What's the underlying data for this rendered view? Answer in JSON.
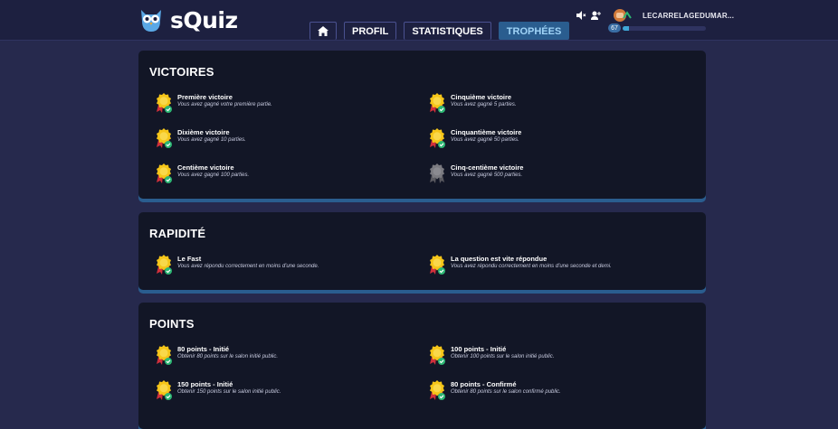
{
  "brand": {
    "name": "sQuiz"
  },
  "nav": {
    "home_icon": "home-icon",
    "tabs": [
      {
        "label": "PROFIL",
        "active": false
      },
      {
        "label": "STATISTIQUES",
        "active": false
      },
      {
        "label": "TROPHÉES",
        "active": true
      }
    ]
  },
  "user": {
    "name": "LECARRELAGEDUMAR...",
    "level": "67",
    "xp_progress_percent": 8
  },
  "colors": {
    "background": "#26294d",
    "panel": "#121626",
    "accent": "#2a5d8f",
    "gold": "#f5c518",
    "check": "#2bb673",
    "locked": "#7a7a80"
  },
  "sections": [
    {
      "title": "VICTOIRES",
      "trophies": [
        {
          "title": "Première victoire",
          "desc": "Vous avez gagné votre première partie.",
          "unlocked": true
        },
        {
          "title": "Cinquième victoire",
          "desc": "Vous avez gagné 5 parties.",
          "unlocked": true
        },
        {
          "title": "Dixième victoire",
          "desc": "Vous avez gagné 10 parties.",
          "unlocked": true
        },
        {
          "title": "Cinquantième victoire",
          "desc": "Vous avez gagné 50 parties.",
          "unlocked": true
        },
        {
          "title": "Centième victoire",
          "desc": "Vous avez gagné 100 parties.",
          "unlocked": true
        },
        {
          "title": "Cinq-centième victoire",
          "desc": "Vous avez gagné 500 parties.",
          "unlocked": false
        }
      ]
    },
    {
      "title": "RAPIDITÉ",
      "trophies": [
        {
          "title": "Le Fast",
          "desc": "Vous avez répondu correctement en moins d'une seconde.",
          "unlocked": true
        },
        {
          "title": "La question est vite répondue",
          "desc": "Vous avez répondu correctement en moins d'une seconde et demi.",
          "unlocked": true
        }
      ]
    },
    {
      "title": "POINTS",
      "trophies": [
        {
          "title": "80 points - Initié",
          "desc": "Obtenir 80 points sur le salon initié public.",
          "unlocked": true
        },
        {
          "title": "100 points - Initié",
          "desc": "Obtenir 100 points sur le salon initié public.",
          "unlocked": true
        },
        {
          "title": "150 points - Initié",
          "desc": "Obtenir 150 points sur le salon initié public.",
          "unlocked": true
        },
        {
          "title": "80 points - Confirmé",
          "desc": "Obtenir 80 points sur le salon confirmé public.",
          "unlocked": true
        }
      ]
    }
  ]
}
